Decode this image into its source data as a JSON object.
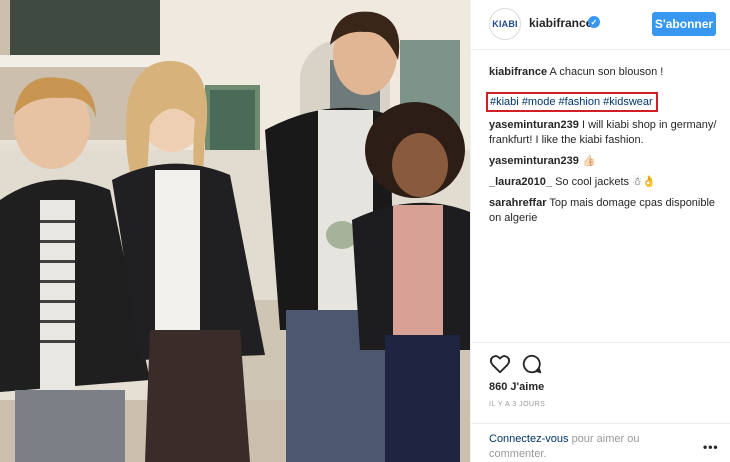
{
  "post": {
    "image_alt": "",
    "header": {
      "avatar_logo_text": "KIABI",
      "username": "kiabifrance",
      "follow_label": "S'abonner"
    },
    "caption": {
      "username": "kiabifrance",
      "text": "A chacun son blouson !",
      "hashtags": [
        "#kiabi",
        "#mode",
        "#fashion",
        "#kidswear"
      ],
      "highlight_color": "#d21f26"
    },
    "comments": [
      {
        "username": "yaseminturan239",
        "text": "I will kiabi shop in germany/ frankfurt! I like the kiabi fashion."
      },
      {
        "username": "yaseminturan239",
        "text": "👍🏻"
      },
      {
        "username": "_laura2010_",
        "text": "So cool jackets ☃👌"
      },
      {
        "username": "sarahreffar",
        "text": "Top mais domage cpas disponible on algerie"
      }
    ],
    "likes": "860 J'aime",
    "time_ago": "IL Y A 3 JOURS",
    "login_prompt": {
      "link": "Connectez-vous",
      "text": "pour aimer ou commenter."
    },
    "more_icon": "ellipsis-icon",
    "colors": {
      "follow_button": "#3897f0",
      "hashtag": "#003569",
      "verified_badge": "#3897f0"
    }
  }
}
